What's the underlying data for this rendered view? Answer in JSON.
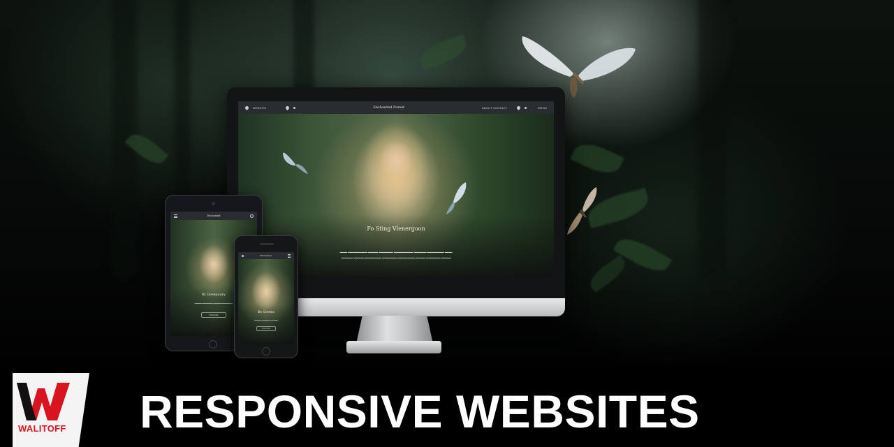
{
  "headline": "RESPONSIVE WEBSITES",
  "brand": {
    "name": "WALITOFF",
    "mark": "W",
    "color": "#d8141e"
  },
  "desktop_site": {
    "nav_left_text": "WEBSITE",
    "logo_text": "Enchanted Forest",
    "nav_right_text": "ABOUT  CONTACT",
    "nav_far_right": "MENU",
    "hero_title": "Fo Sting Vlenergoon"
  },
  "tablet_site": {
    "logo_text": "Enchanted",
    "hero_title": "Ri Greenaury",
    "button_label": "DISCOVER"
  },
  "phone_site": {
    "logo_text": "Enchanted",
    "hero_title": "Be Greens",
    "button_label": "DISCOVER"
  },
  "icons": [
    "location-pin-icon",
    "menu-icon",
    "search-icon"
  ]
}
